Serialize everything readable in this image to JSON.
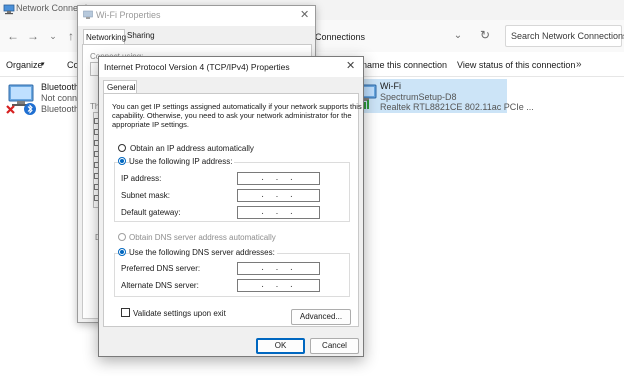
{
  "network_connections": {
    "title": "Network Connections",
    "address_path": "Connections",
    "search_placeholder": "Search Network Connections",
    "commands": {
      "organize": "Organize",
      "organize_caret": "▾",
      "connect_to_partial": "Co",
      "rename": "name this connection",
      "view_status": "View status of this connection",
      "more": "»"
    },
    "adapters": [
      {
        "name": "Bluetooth",
        "status": "Not conn",
        "device": "Bluetooth"
      },
      {
        "name": "Wi-Fi",
        "status": "SpectrumSetup-D8",
        "device": "Realtek RTL8821CE 802.11ac PCIe ..."
      }
    ]
  },
  "wifi_properties": {
    "title": "Wi-Fi Properties",
    "tabs": [
      "Networking",
      "Sharing"
    ],
    "connect_using_label": "Connect using:",
    "this_connection_partial": "Th",
    "description_partial": "D"
  },
  "ipv4_dialog": {
    "title": "Internet Protocol Version 4 (TCP/IPv4) Properties",
    "tab": "General",
    "description": "You can get IP settings assigned automatically if your network supports this capability. Otherwise, you need to ask your network administrator for the appropriate IP settings.",
    "ip_mode": {
      "auto_label": "Obtain an IP address automatically",
      "manual_label": "Use the following IP address:",
      "selected": "manual"
    },
    "ip_fields": [
      {
        "label": "IP address:",
        "value": ". . ."
      },
      {
        "label": "Subnet mask:",
        "value": ". . ."
      },
      {
        "label": "Default gateway:",
        "value": ". . ."
      }
    ],
    "dns_mode": {
      "auto_label": "Obtain DNS server address automatically",
      "manual_label": "Use the following DNS server addresses:",
      "selected": "manual"
    },
    "dns_fields": [
      {
        "label": "Preferred DNS server:",
        "value": ". . ."
      },
      {
        "label": "Alternate DNS server:",
        "value": ". . ."
      }
    ],
    "validate_label": "Validate settings upon exit",
    "validate_checked": false,
    "buttons": {
      "advanced": "Advanced...",
      "ok": "OK",
      "cancel": "Cancel"
    },
    "close_glyph": "✕"
  },
  "colors": {
    "accent": "#0067c0",
    "selection": "#cce4f7",
    "dialog_bg": "#f0f0f0"
  },
  "icons": [
    "network-connections-icon",
    "back-arrow-icon",
    "forward-arrow-icon",
    "chevron-down-icon",
    "up-arrow-icon",
    "refresh-icon",
    "network-adapter-icon",
    "bluetooth-icon",
    "error-x-icon",
    "wifi-signal-icon",
    "close-icon"
  ]
}
